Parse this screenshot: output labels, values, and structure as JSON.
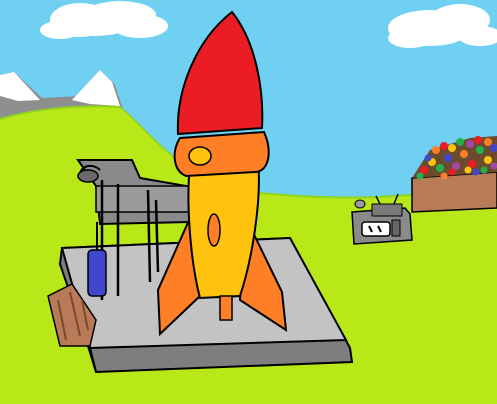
{
  "scene": {
    "description_free": true,
    "colors": {
      "sky": "#70d0f2",
      "cloud": "#ffffff",
      "mountain": "#8e8e8e",
      "snow": "#ffffff",
      "grass_back": "#8ed41c",
      "grass_front": "#b9e818",
      "pad": "#c3c3c3",
      "pad_shadow": "#7e7e7e",
      "rocket_nose": "#ec1c24",
      "rocket_body": "#ffc20e",
      "rocket_band": "#ff7f27",
      "rocket_fin": "#ff7f27",
      "tower": "#8a8a8a",
      "tank": "#3f48cc",
      "crate": "#b97a57",
      "bin": "#b97a57",
      "outline": "#000000"
    },
    "elements": [
      "cloud-left",
      "cloud-right",
      "mountain-range",
      "grass-field",
      "launch-pad",
      "gantry-tower",
      "blue-tank",
      "wooden-crates",
      "rocket",
      "robot-machine",
      "ball-bin"
    ]
  }
}
